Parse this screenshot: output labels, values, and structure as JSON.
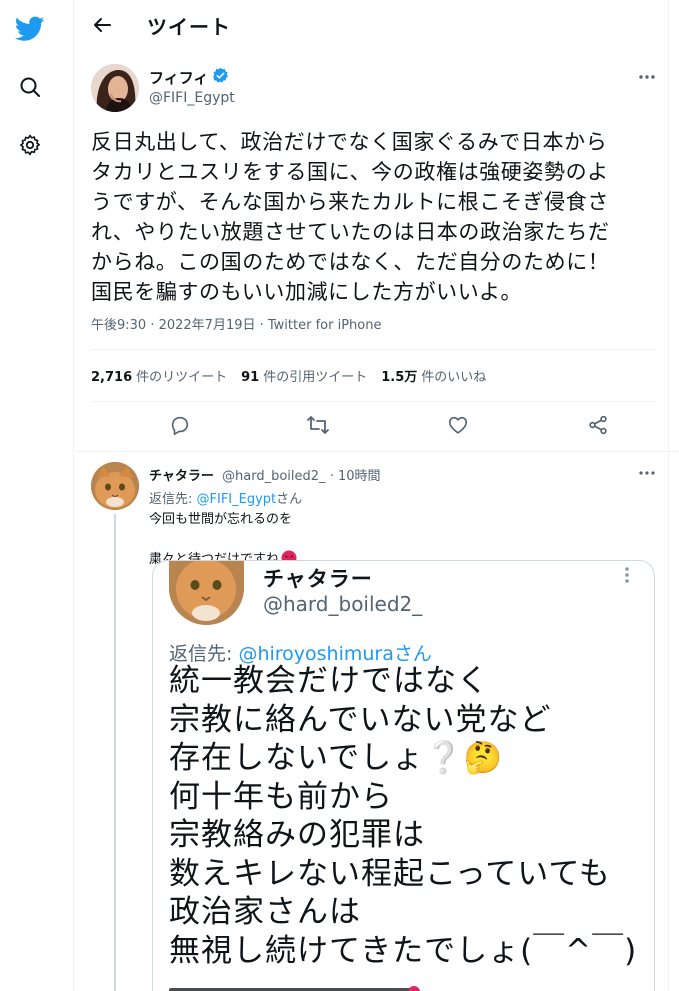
{
  "colors": {
    "brand": "#1d9bf0",
    "text": "#0f1419",
    "muted": "#536471",
    "border": "#eff3f4",
    "verified": "#1d9bf0"
  },
  "header": {
    "title": "ツイート"
  },
  "tweet": {
    "author_name": "フィフィ",
    "author_handle": "@FIFI_Egypt",
    "text": "反日丸出して、政治だけでなく国家ぐるみで日本から\nタカリとユスリをする国に、今の政権は強硬姿勢のよ\nうですが、そんな国から来たカルトに根こそぎ侵食さ\nれ、やりたい放題させていたのは日本の政治家たちだ\nからね。この国のためではなく、ただ自分のために！\n国民を騙すのもいい加減にした方がいいよ。",
    "meta": "午後9:30 · 2022年7月19日 · Twitter for iPhone",
    "retweets_count": "2,716",
    "retweets_label": "件のリツイート",
    "quotes_count": "91",
    "quotes_label": "件の引用ツイート",
    "likes_count": "1.5万",
    "likes_label": "件のいいね"
  },
  "reply": {
    "author_name": "チャタラー",
    "author_handle": "@hard_boiled2_",
    "time": "· 10時間",
    "reply_to_prefix": "返信先: ",
    "reply_to_handle": "@FIFI_Egypt",
    "reply_to_suffix": "さん",
    "text": "今回も世間が忘れるのを\n粛々と待つだけですね",
    "image": {
      "author_name": "チャタラー",
      "author_handle": "@hard_boiled2_",
      "reply_to_prefix": "返信先: ",
      "reply_to_handle": "@hiroyoshimura",
      "reply_to_suffix": "さん",
      "text": "統一教会だけではなく\n宗教に絡んでいない党など\n存在しないでしょ❔🤔\n何十年も前から\n宗教絡みの犯罪は\n数えキレない程起こっていても\n政治家さんは\n無視し続けてきたでしょ(￣^￣)"
    }
  }
}
